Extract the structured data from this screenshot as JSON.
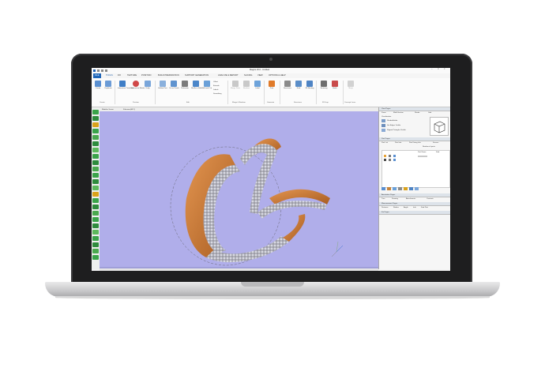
{
  "window": {
    "title": "Magics 26.0 - Untitled"
  },
  "menu": [
    "FILE",
    "TOOLS",
    "FIX",
    "TEXTURE",
    "POSITION",
    "BUILD PREPARATION",
    "SUPPORT GENERATION",
    "ANALYZE & REPORT",
    "SLICING",
    "VIEW",
    "OPTIONS & HELP"
  ],
  "ribbon": {
    "buttons": [
      "Create",
      "Duplicate",
      "Interactive Translate",
      "Interactive Rotate",
      "Unify",
      "Hollow Part",
      "Cut or Punch",
      "Perforator",
      "Shells to Solid",
      "Hull and Cut",
      "Offset",
      "Extrude",
      "Labels",
      "Smoothing",
      "Merge Parts",
      "Boolean",
      "Label",
      "Print",
      "Structures",
      "Kind",
      "3D Nesting",
      "Sintering",
      "Hatch",
      "Sleep"
    ],
    "groups": [
      "Create",
      "Position",
      "Edit",
      "Merge & Boolean",
      "Generate",
      "Structures",
      "FDCrop",
      "Concept Laser"
    ]
  },
  "view": {
    "tabs": [
      "Modeler Scene",
      "Filename(Mt 2)"
    ]
  },
  "right_panel": {
    "view_pages_title": "View Pages",
    "view_tabs": [
      "Zoom",
      "Multi-Section",
      "Shade",
      "Grid"
    ],
    "visualization_label": "Visualization",
    "view_items": [
      "Shaded/white",
      "Set Edges Visible",
      "Flipped Triangles Visible"
    ],
    "part_pages_title": "Part Pages",
    "part_tabs": [
      "Part List",
      "Part Info",
      "Part Fixing Info",
      "Scenes"
    ],
    "part_count_label": "Number of parts:",
    "part_list_headers": [
      "Part Name",
      "Fold"
    ],
    "annotation_title": "Annotation Pages",
    "annotation_tabs": [
      "Tree",
      "Drawing",
      "Attachments",
      "Contents"
    ],
    "measurement_title": "Measurement Pages",
    "measurement_tabs": [
      "Distance",
      "Radius",
      "Angle",
      "Info",
      "Find Part"
    ],
    "fix_title": "Fix Pages"
  },
  "colors": {
    "viewport": "#b0aeea",
    "model": "#c97a3b",
    "mesh": "#c9cbd6"
  }
}
